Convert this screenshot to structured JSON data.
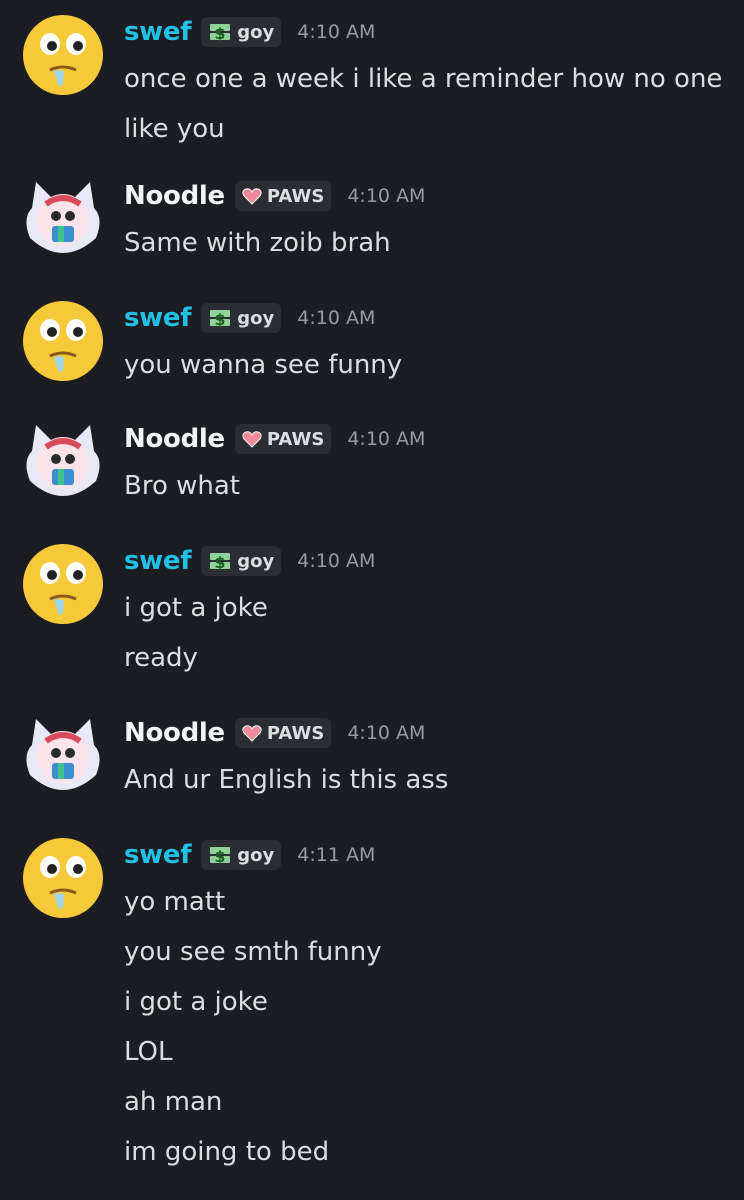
{
  "colors": {
    "background": "#1c1d22",
    "swef_name": "#21c1e6",
    "noodle_name": "#f2f3f5",
    "tag_text": "#dbdee1",
    "timestamp": "#949ba4",
    "message_text": "#dbdee1"
  },
  "users": {
    "swef": {
      "name": "swef",
      "tag": "goy",
      "tag_icon": "dollar-bills-icon",
      "avatar": "drooling-face-avatar"
    },
    "noodle": {
      "name": "Noodle",
      "tag": "PAWS",
      "tag_icon": "heart-icon",
      "avatar": "cat-ears-avatar"
    }
  },
  "messages": [
    {
      "author": "swef",
      "time": "4:10 AM",
      "lines": [
        "once one a week i like a reminder how no one",
        "like you"
      ]
    },
    {
      "author": "noodle",
      "time": "4:10 AM",
      "lines": [
        "Same with zoib brah"
      ]
    },
    {
      "author": "swef",
      "time": "4:10 AM",
      "lines": [
        "you wanna see funny"
      ]
    },
    {
      "author": "noodle",
      "time": "4:10 AM",
      "lines": [
        "Bro what"
      ]
    },
    {
      "author": "swef",
      "time": "4:10 AM",
      "lines": [
        "i got a joke",
        "ready"
      ]
    },
    {
      "author": "noodle",
      "time": "4:10 AM",
      "lines": [
        "And ur English is this ass"
      ]
    },
    {
      "author": "swef",
      "time": "4:11 AM",
      "lines": [
        "yo matt",
        "you see smth funny",
        "i got a joke",
        "LOL",
        "ah man",
        "im going to bed"
      ]
    }
  ]
}
